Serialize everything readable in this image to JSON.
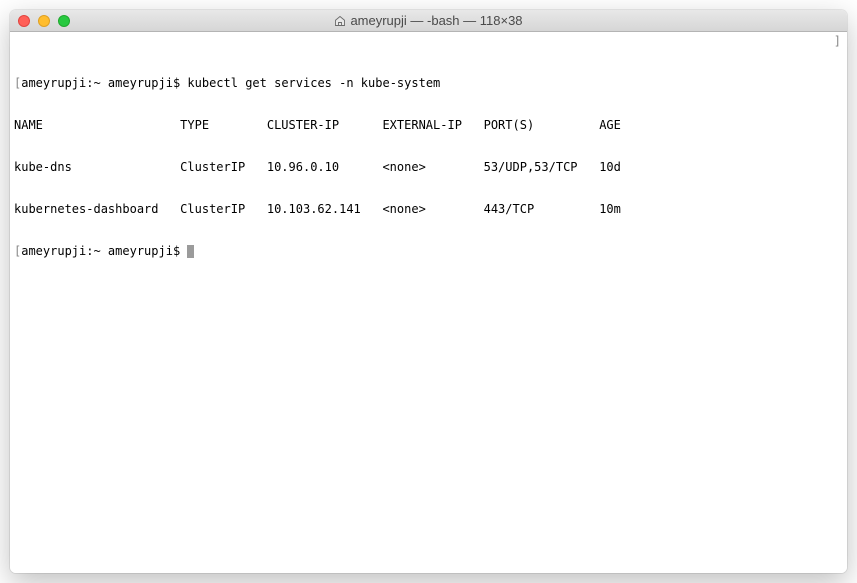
{
  "window": {
    "title": "ameyrupji — -bash — 118×38"
  },
  "terminal": {
    "prompt1": {
      "bracket_open": "[",
      "user_host": "ameyrupji:~ ameyrupji$ ",
      "command": "kubectl get services -n kube-system"
    },
    "output": {
      "headers": {
        "name": "NAME",
        "type": "TYPE",
        "cluster_ip": "CLUSTER-IP",
        "external_ip": "EXTERNAL-IP",
        "ports": "PORT(S)",
        "age": "AGE"
      },
      "rows": [
        {
          "name": "kube-dns",
          "type": "ClusterIP",
          "cluster_ip": "10.96.0.10",
          "external_ip": "<none>",
          "ports": "53/UDP,53/TCP",
          "age": "10d"
        },
        {
          "name": "kubernetes-dashboard",
          "type": "ClusterIP",
          "cluster_ip": "10.103.62.141",
          "external_ip": "<none>",
          "ports": "443/TCP",
          "age": "10m"
        }
      ]
    },
    "prompt2": {
      "bracket_open": "[",
      "user_host": "ameyrupji:~ ameyrupji$ "
    },
    "bracket_close": "]"
  },
  "columns": {
    "name_width": 23,
    "type_width": 12,
    "cluster_ip_width": 16,
    "external_ip_width": 14,
    "ports_width": 16
  }
}
